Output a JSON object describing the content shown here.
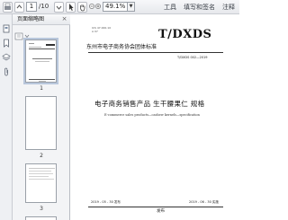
{
  "toolbar": {
    "page_current": "1",
    "page_total": "/10",
    "zoom": "49.1%",
    "menu_tools": "工具",
    "menu_fill_sign": "填写和签名",
    "menu_comment": "注释"
  },
  "thumbnail_panel": {
    "title": "页面缩略图",
    "close": "×",
    "pages": [
      {
        "number": "1"
      },
      {
        "number": "2"
      },
      {
        "number": "3"
      }
    ]
  },
  "document": {
    "ics": "ICS 47.000.10",
    "ccs": "A 07",
    "organization": "东州市电子商务协会团体标准",
    "standard_code": "T/DXDS",
    "standard_number": "T/DXDS 002—2019",
    "title_cn": "电子商务销售产品  生干腰果仁  规格",
    "title_en": "E-commerce sales products—cashew kernels—specification",
    "publish_date": "2019 - 05 - 30 发布",
    "effective_date": "2019 - 06 - 30 实施",
    "issuer": "发布"
  },
  "icons": {
    "rail": [
      "pages-icon",
      "bookmark-icon",
      "layers-icon",
      "paperclip-icon"
    ],
    "toolbar": [
      "print-icon",
      "prev-page-icon",
      "next-page-icon",
      "cursor-icon",
      "hand-icon",
      "zoom-out-icon",
      "zoom-in-icon"
    ]
  }
}
